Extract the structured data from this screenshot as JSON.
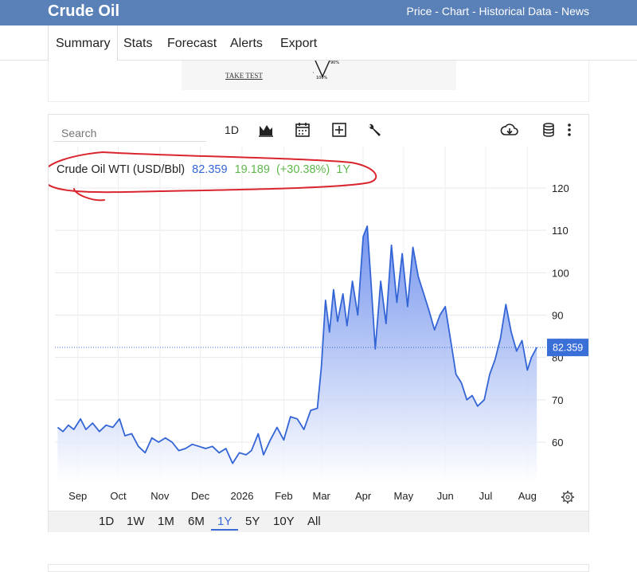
{
  "header": {
    "title": "Crude Oil",
    "links": "Price - Chart - Historical Data - News"
  },
  "nav": {
    "tabs": [
      "Summary",
      "Stats",
      "Forecast",
      "Alerts",
      "Export"
    ],
    "active": "Summary"
  },
  "ad": {
    "text": "TAKE TEST",
    "dial_top": "90%",
    "dial_left": "0%",
    "dial_bottom": "100%"
  },
  "toolbar": {
    "search_placeholder": "Search",
    "interval": "1D"
  },
  "ranges": [
    "1D",
    "1W",
    "1M",
    "6M",
    "1Y",
    "5Y",
    "10Y",
    "All"
  ],
  "active_range": "1Y",
  "colors": {
    "line": "#3465d6",
    "fill_top": "#5d82ea",
    "fill_bottom": "#ffffff",
    "price_tag": "#3b6fd8",
    "positive": "#5fb84c",
    "annotation": "#d9262e"
  },
  "chart_data": {
    "type": "area",
    "legend": {
      "name": "Crude Oil WTI (USD/Bbl)",
      "price": "82.359",
      "change": "19.189",
      "change_pct": "(+30.38%)",
      "period": "1Y"
    },
    "last_price_label": "82.359",
    "last_price": 82.359,
    "ylim": [
      50,
      125
    ],
    "yticks": [
      60,
      70,
      80,
      90,
      100,
      110,
      120
    ],
    "ytick_labels": [
      "60",
      "70",
      "80",
      "90",
      "100",
      "110",
      "120"
    ],
    "xlim": [
      "2025-08-15",
      "2026-08-15"
    ],
    "xticks": [
      {
        "label": "Sep",
        "date": "2025-09-01"
      },
      {
        "label": "Oct",
        "date": "2025-10-01"
      },
      {
        "label": "Nov",
        "date": "2025-11-01"
      },
      {
        "label": "Dec",
        "date": "2025-12-01"
      },
      {
        "label": "2026",
        "date": "2026-01-01"
      },
      {
        "label": "Feb",
        "date": "2026-02-01"
      },
      {
        "label": "Mar",
        "date": "2026-03-01"
      },
      {
        "label": "Apr",
        "date": "2026-04-01"
      },
      {
        "label": "May",
        "date": "2026-05-01"
      },
      {
        "label": "Jun",
        "date": "2026-06-01"
      },
      {
        "label": "Jul",
        "date": "2026-07-01"
      },
      {
        "label": "Aug",
        "date": "2026-08-01"
      }
    ],
    "grid": true,
    "series": [
      {
        "x": [
          "2025-08-17",
          "2025-08-21",
          "2025-08-25",
          "2025-08-29",
          "2025-09-03",
          "2025-09-07",
          "2025-09-12",
          "2025-09-17",
          "2025-09-22",
          "2025-09-27",
          "2025-10-02",
          "2025-10-06",
          "2025-10-11",
          "2025-10-16",
          "2025-10-21",
          "2025-10-26",
          "2025-10-31",
          "2025-11-05",
          "2025-11-10",
          "2025-11-15",
          "2025-11-20",
          "2025-11-25",
          "2025-11-30",
          "2025-12-05",
          "2025-12-10",
          "2025-12-15",
          "2025-12-20",
          "2025-12-25",
          "2025-12-30",
          "2026-01-04",
          "2026-01-08",
          "2026-01-13",
          "2026-01-17",
          "2026-01-22",
          "2026-01-27",
          "2026-02-01",
          "2026-02-06",
          "2026-02-11",
          "2026-02-16",
          "2026-02-21",
          "2026-02-26",
          "2026-03-01",
          "2026-03-04",
          "2026-03-07",
          "2026-03-10",
          "2026-03-13",
          "2026-03-17",
          "2026-03-20",
          "2026-03-24",
          "2026-03-28",
          "2026-04-01",
          "2026-04-04",
          "2026-04-07",
          "2026-04-10",
          "2026-04-14",
          "2026-04-18",
          "2026-04-22",
          "2026-04-26",
          "2026-04-30",
          "2026-05-04",
          "2026-05-08",
          "2026-05-12",
          "2026-05-16",
          "2026-05-20",
          "2026-05-24",
          "2026-05-28",
          "2026-06-01",
          "2026-06-05",
          "2026-06-09",
          "2026-06-13",
          "2026-06-17",
          "2026-06-21",
          "2026-06-25",
          "2026-06-30",
          "2026-07-04",
          "2026-07-08",
          "2026-07-12",
          "2026-07-16",
          "2026-07-20",
          "2026-07-24",
          "2026-07-28",
          "2026-08-01",
          "2026-08-04",
          "2026-08-08"
        ],
        "y": [
          63.5,
          62.5,
          64.0,
          63.0,
          65.5,
          63.0,
          64.5,
          62.5,
          64.0,
          63.5,
          65.5,
          61.5,
          62.0,
          59.0,
          57.5,
          61.0,
          60.0,
          61.0,
          60.0,
          58.0,
          58.5,
          59.5,
          59.0,
          58.5,
          59.0,
          57.5,
          58.5,
          55.0,
          57.5,
          57.0,
          58.0,
          62.0,
          57.0,
          60.5,
          63.5,
          60.5,
          66.0,
          65.5,
          63.0,
          67.5,
          68.0,
          78.0,
          93.5,
          86.0,
          96.0,
          88.5,
          95.0,
          87.5,
          98.0,
          90.0,
          108.5,
          111.0,
          97.0,
          82.0,
          98.0,
          88.0,
          106.5,
          93.0,
          104.5,
          92.0,
          106.0,
          99.0,
          95.0,
          91.0,
          86.5,
          90.0,
          92.0,
          84.0,
          76.0,
          74.0,
          70.0,
          71.0,
          68.5,
          70.0,
          76.0,
          79.5,
          84.5,
          92.5,
          86.0,
          81.5,
          84.0,
          77.0,
          80.0,
          82.359
        ]
      }
    ]
  }
}
